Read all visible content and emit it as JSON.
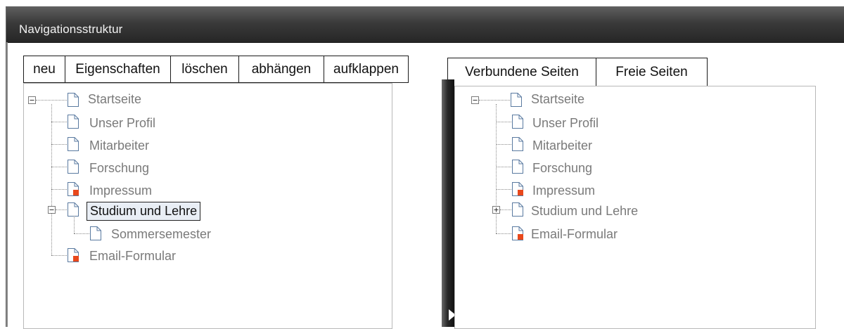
{
  "window": {
    "title": "Navigationsstruktur"
  },
  "toolbar": {
    "new_label": "neu",
    "properties_label": "Eigenschaften",
    "delete_label": "löschen",
    "detach_label": "abhängen",
    "expand_label": "aufklappen"
  },
  "right_tabs": {
    "linked_label": "Verbundene Seiten",
    "free_label": "Freie Seiten"
  },
  "left_tree": {
    "root": "Startseite",
    "items": [
      {
        "label": "Unser Profil",
        "icon": "page-icon"
      },
      {
        "label": "Mitarbeiter",
        "icon": "page-icon"
      },
      {
        "label": "Forschung",
        "icon": "page-icon"
      },
      {
        "label": "Impressum",
        "icon": "page-special-icon"
      },
      {
        "label": "Studium und Lehre",
        "icon": "page-icon",
        "expanded": true,
        "selected": true
      },
      {
        "label": "Sommersemester",
        "icon": "page-icon"
      },
      {
        "label": "Email-Formular",
        "icon": "page-special-icon"
      }
    ]
  },
  "right_tree": {
    "root": "Startseite",
    "items": [
      {
        "label": "Unser Profil",
        "icon": "page-icon"
      },
      {
        "label": "Mitarbeiter",
        "icon": "page-icon"
      },
      {
        "label": "Forschung",
        "icon": "page-icon"
      },
      {
        "label": "Impressum",
        "icon": "page-special-icon"
      },
      {
        "label": "Studium und Lehre",
        "icon": "page-icon",
        "expanded": false
      },
      {
        "label": "Email-Formular",
        "icon": "page-special-icon"
      }
    ]
  },
  "colors": {
    "titlebar": "#2e2e2e",
    "tree_text": "#7a7a7a",
    "special_page_marker": "#e8481c",
    "selected_background": "#e9eef5"
  }
}
